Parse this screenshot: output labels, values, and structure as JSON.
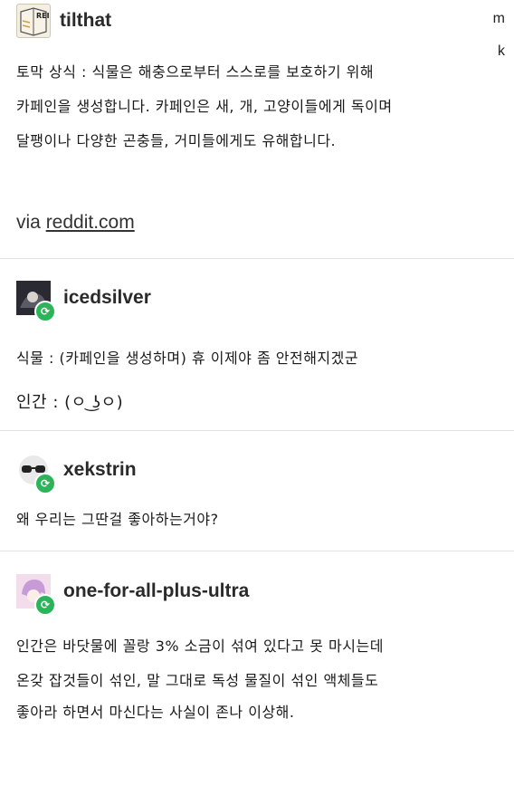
{
  "side_letters": [
    "m",
    "k"
  ],
  "posts": [
    {
      "username": "tilthat",
      "avatar_text": "REI",
      "lines": [
        "토막 상식 : 식물은 해충으로부터 스스로를 보호하기 위해",
        "카페인을 생성합니다. 카페인은 새, 개, 고양이들에게 독이며",
        "달팽이나 다양한 곤충들, 거미들에게도 유해합니다."
      ],
      "via_prefix": "via ",
      "via_link": "reddit.com"
    },
    {
      "username": "icedsilver",
      "lines": [
        "식물 : (카페인을 생성하며) 휴 이제야 좀 안전해지겠군",
        "인간 : (ㅇ ͜ʖㅇ)"
      ]
    },
    {
      "username": "xekstrin",
      "lines": [
        "왜 우리는 그딴걸 좋아하는거야?"
      ]
    },
    {
      "username": "one-for-all-plus-ultra",
      "lines": [
        "인간은 바닷물에 꼴랑 3% 소금이 섞여 있다고 못 마시는데",
        "온갖 잡것들이 섞인, 말 그대로 독성 물질이 섞인 액체들도",
        "좋아라 하면서 마신다는 사실이 존나 이상해."
      ]
    }
  ]
}
